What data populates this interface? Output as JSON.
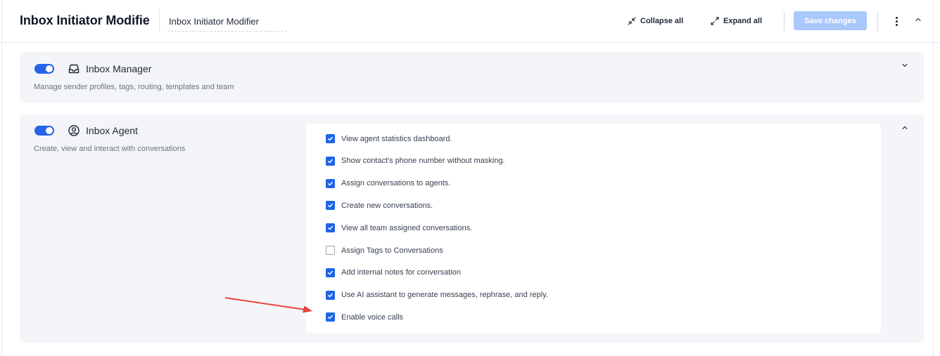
{
  "header": {
    "title": "Inbox Initiator Modifie",
    "name_value": "Inbox Initiator Modifier",
    "collapse_label": "Collapse all",
    "expand_label": "Expand all",
    "save_label": "Save changes",
    "collapse_icon": "collapse-arrows-icon",
    "expand_icon": "expand-arrows-icon",
    "more_icon": "kebab-menu-icon",
    "caret_icon": "chevron-up-icon"
  },
  "colors": {
    "accent": "#2563eb",
    "save_disabled": "#a9c8fb",
    "card_bg": "#f3f5f8",
    "annotation_arrow": "#e8443a"
  },
  "sections": [
    {
      "title": "Inbox Manager",
      "description": "Manage sender profiles, tags, routing, templates and team",
      "enabled": true,
      "expanded": false,
      "icon": "inbox-tray-icon"
    },
    {
      "title": "Inbox Agent",
      "description": "Create, view and interact with conversations",
      "enabled": true,
      "expanded": true,
      "icon": "user-circle-icon",
      "permissions": [
        {
          "label": "View agent statistics dashboard.",
          "checked": true
        },
        {
          "label": "Show contact's phone number without masking.",
          "checked": true
        },
        {
          "label": "Assign conversations to agents.",
          "checked": true
        },
        {
          "label": "Create new conversations.",
          "checked": true
        },
        {
          "label": "View all team assigned conversations.",
          "checked": true
        },
        {
          "label": "Assign Tags to Conversations",
          "checked": false
        },
        {
          "label": "Add internal notes for conversation",
          "checked": true
        },
        {
          "label": "Use AI assistant to generate messages, rephrase, and reply.",
          "checked": true
        },
        {
          "label": "Enable voice calls",
          "checked": true
        }
      ]
    }
  ]
}
